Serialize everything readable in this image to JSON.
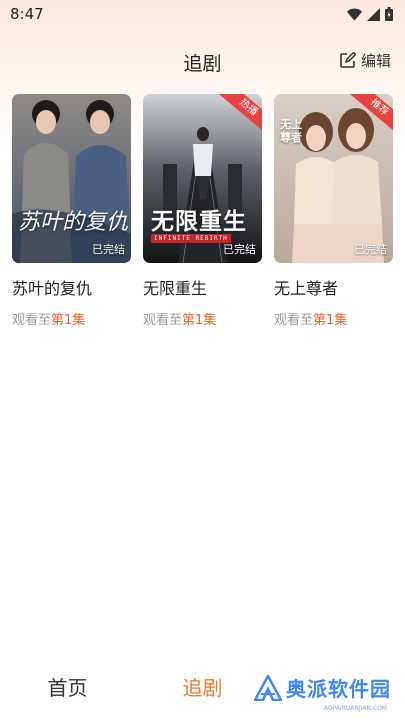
{
  "status_bar": {
    "time": "8:47"
  },
  "header": {
    "title": "追剧",
    "edit_label": "编辑"
  },
  "dramas": [
    {
      "title": "苏叶的复仇",
      "cover_title": "苏叶的复仇",
      "status": "已完结",
      "progress_prefix": "观看至",
      "episode": "第1集"
    },
    {
      "title": "无限重生",
      "cover_title": "无限重生",
      "cover_subtitle": "INFINITE REBIRTH",
      "badge": "热播",
      "status": "已完结",
      "progress_prefix": "观看至",
      "episode": "第1集"
    },
    {
      "title": "无上尊者",
      "cover_title": "无上尊者",
      "badge": "推荐",
      "status": "已完结",
      "progress_prefix": "观看至",
      "episode": "第1集"
    }
  ],
  "nav": {
    "home": "首页",
    "follow": "追剧"
  },
  "watermark": {
    "text": "奥派软件园",
    "sub": "AOPAIRUANJIAN.COM"
  },
  "colors": {
    "accent": "#f07a2a",
    "episode": "#e8622a",
    "badge": "#e84141"
  }
}
